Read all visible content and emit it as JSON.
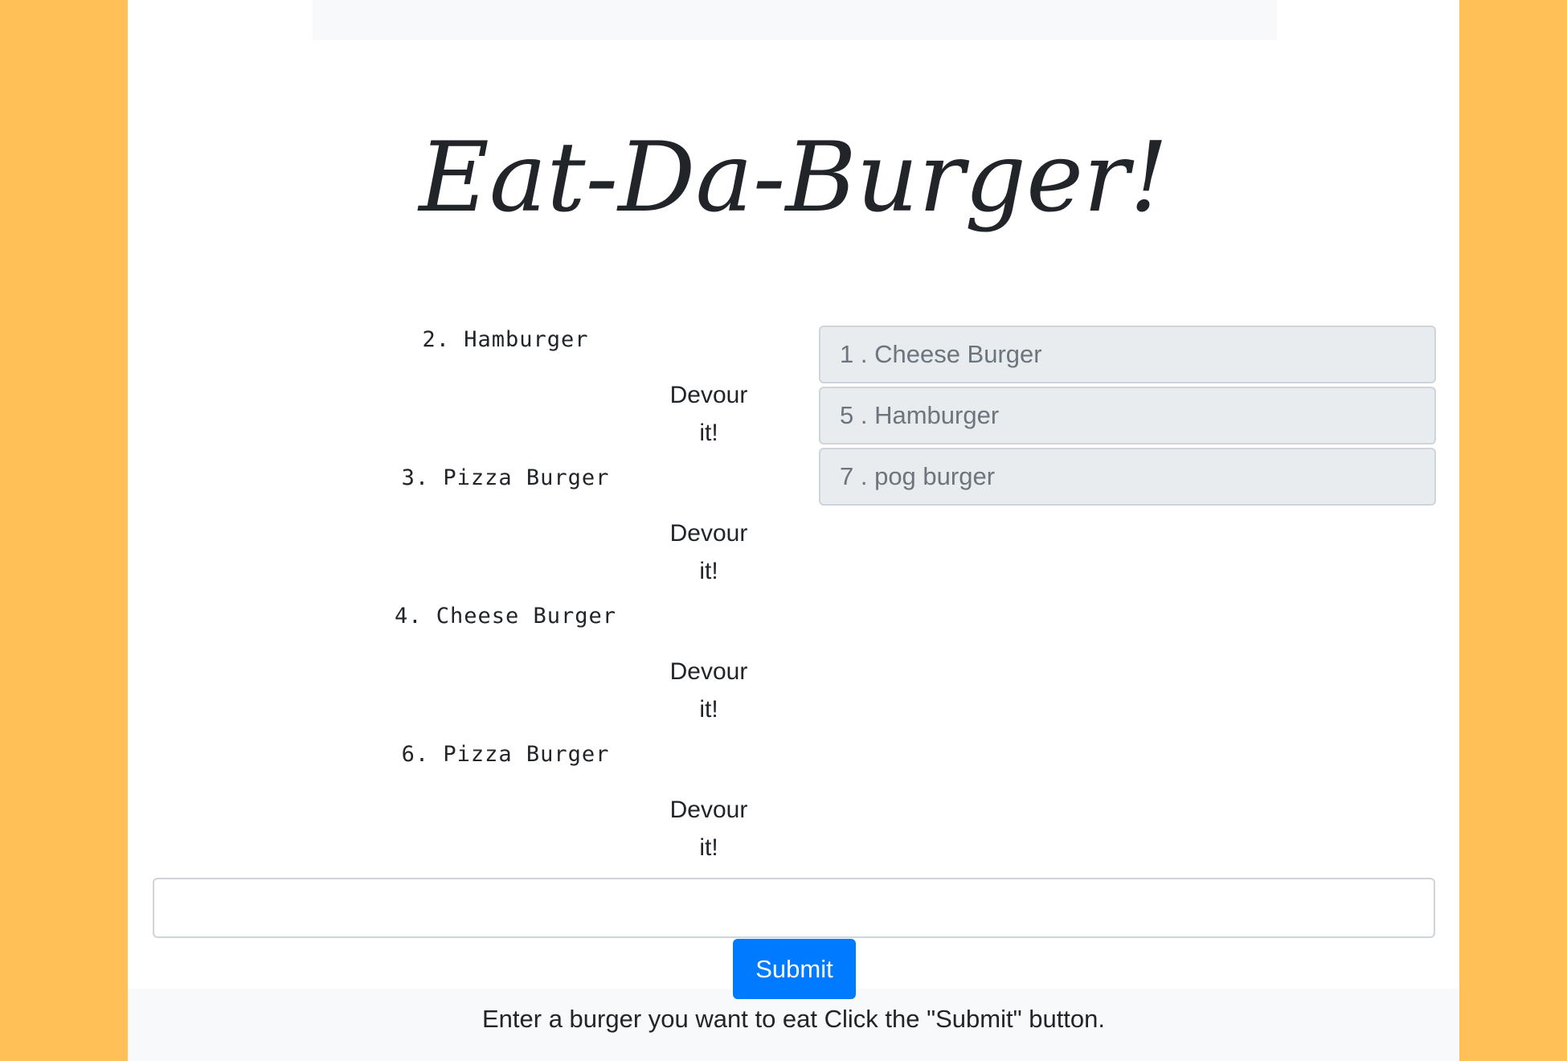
{
  "page": {
    "title": "Eat-Da-Burger!"
  },
  "burgers": [
    {
      "name": "2. Hamburger",
      "devour_line1": "Devour",
      "devour_line2": "it!"
    },
    {
      "name": "3. Pizza Burger",
      "devour_line1": "Devour",
      "devour_line2": "it!"
    },
    {
      "name": "4. Cheese Burger",
      "devour_line1": "Devour",
      "devour_line2": "it!"
    },
    {
      "name": "6. Pizza Burger",
      "devour_line1": "Devour",
      "devour_line2": "it!"
    }
  ],
  "devoured": [
    {
      "label": "1 . Cheese Burger"
    },
    {
      "label": "5 . Hamburger"
    },
    {
      "label": "7 . pog burger"
    }
  ],
  "form": {
    "input_value": "",
    "submit_label": "Submit",
    "instructions": "Enter a burger you want to eat Click the \"Submit\" button."
  },
  "colors": {
    "background": "#FEC057",
    "submit": "#007bff",
    "devoured_item_bg": "#e9ecef"
  }
}
